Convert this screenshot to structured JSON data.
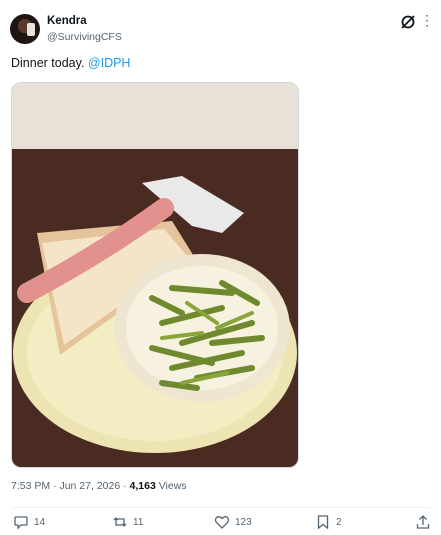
{
  "author": {
    "name": "Kendra",
    "handle": "@SurvivingCFS"
  },
  "tweet": {
    "text": "Dinner today.",
    "mention": "@IDPH"
  },
  "meta": {
    "time": "7:53 PM",
    "date": "Jun 27, 2026",
    "views_count": "4,163",
    "views_label": "Views"
  },
  "actions": {
    "replies": "14",
    "retweets": "11",
    "likes": "123",
    "bookmarks": "2"
  },
  "icons": [
    "grok-icon",
    "more-icon",
    "reply-icon",
    "retweet-icon",
    "like-icon",
    "bookmark-icon",
    "share-icon"
  ]
}
